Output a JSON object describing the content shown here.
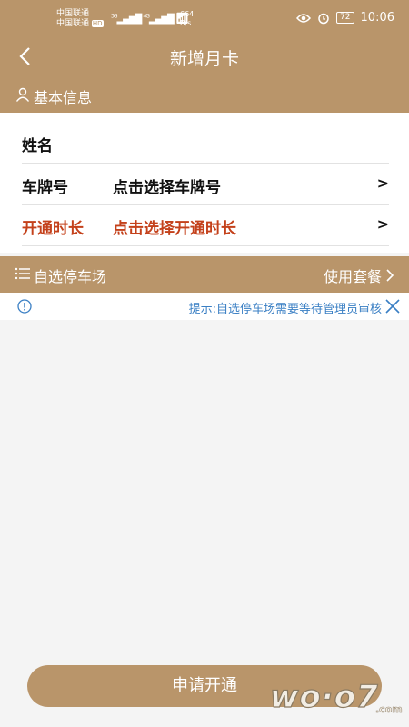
{
  "status_bar": {
    "carrier1": "中国联通",
    "carrier2": "中国联通",
    "hd": "HD",
    "net1": "3G",
    "net2": "4G",
    "speed_value": "664",
    "speed_unit": "B/s",
    "battery": "72",
    "time": "10:06"
  },
  "header": {
    "title": "新增月卡",
    "back_icon": "chevron-left-icon"
  },
  "basic_info": {
    "label": "基本信息",
    "icon": "user-icon"
  },
  "form": {
    "name_label": "姓名",
    "plate_label": "车牌号",
    "plate_placeholder": "点击选择车牌号",
    "duration_label": "开通时长",
    "duration_placeholder": "点击选择开通时长",
    "arrow": ">"
  },
  "parking": {
    "label": "自选停车场",
    "package_label": "使用套餐",
    "icon": "list-icon"
  },
  "tip": {
    "text": "提示:自选停车场需要等待管理员审核"
  },
  "apply_button": "申请开通",
  "watermark": "wo·o7.com",
  "colors": {
    "brand": "#b9956a",
    "required_label": "#c4411b",
    "tip_text": "#3a7fc4"
  }
}
